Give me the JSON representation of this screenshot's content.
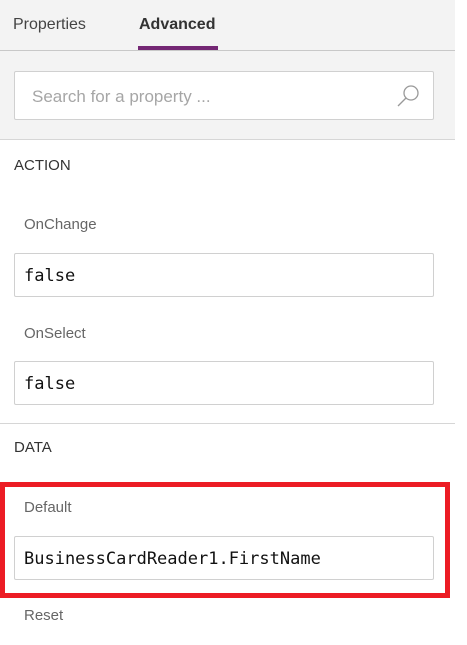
{
  "tabs": [
    {
      "label": "Properties",
      "active": false
    },
    {
      "label": "Advanced",
      "active": true
    }
  ],
  "search": {
    "placeholder": "Search for a property ...",
    "icon": "search-icon"
  },
  "sections": [
    {
      "title": "ACTION",
      "properties": [
        {
          "label": "OnChange",
          "value": "false"
        },
        {
          "label": "OnSelect",
          "value": "false"
        }
      ]
    },
    {
      "title": "DATA",
      "properties": [
        {
          "label": "Default",
          "value": "BusinessCardReader1.FirstName",
          "highlighted": true
        },
        {
          "label": "Reset"
        }
      ]
    }
  ],
  "colors": {
    "accent": "#742774",
    "highlight": "#ec1c24"
  }
}
